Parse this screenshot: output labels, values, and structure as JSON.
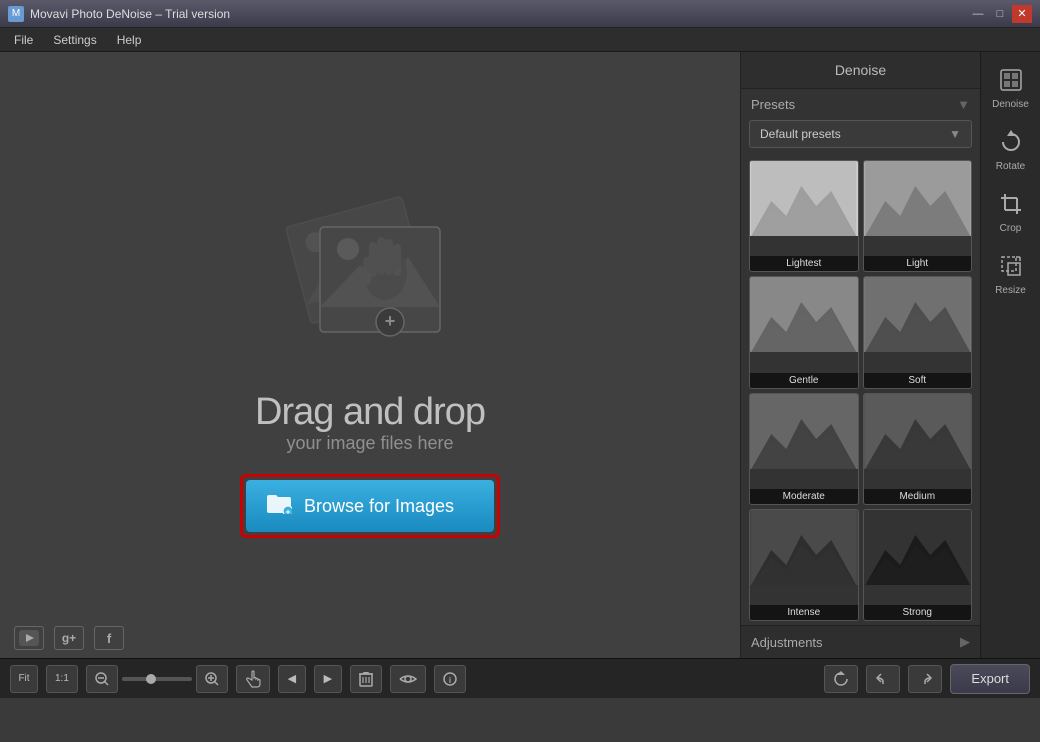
{
  "window": {
    "title": "Movavi Photo DeNoise – Trial version",
    "icon": "M"
  },
  "title_controls": {
    "minimize": "—",
    "maximize": "□",
    "close": "✕"
  },
  "menu": {
    "items": [
      "File",
      "Settings",
      "Help"
    ]
  },
  "canvas": {
    "drag_title": "Drag and drop",
    "drag_subtitle": "your image files here",
    "browse_label": "Browse for Images"
  },
  "social": {
    "youtube": "▶",
    "gplus": "g+",
    "facebook": "f"
  },
  "right_panel": {
    "header": "Denoise",
    "presets_label": "Presets",
    "default_presets": "Default presets",
    "adjustments_label": "Adjustments",
    "presets": [
      {
        "id": "lightest",
        "label": "Lightest",
        "brightness": 85
      },
      {
        "id": "light",
        "label": "Light",
        "brightness": 70
      },
      {
        "id": "gentle",
        "label": "Gentle",
        "brightness": 60
      },
      {
        "id": "soft",
        "label": "Soft",
        "brightness": 55
      },
      {
        "id": "moderate",
        "label": "Moderate",
        "brightness": 50
      },
      {
        "id": "medium",
        "label": "Medium",
        "brightness": 45
      },
      {
        "id": "intense",
        "label": "Intense",
        "brightness": 35
      },
      {
        "id": "strong",
        "label": "Strong",
        "brightness": 30
      }
    ]
  },
  "toolbar": {
    "tools": [
      {
        "id": "denoise",
        "label": "Denoise",
        "icon": "⊞"
      },
      {
        "id": "rotate",
        "label": "Rotate",
        "icon": "↻"
      },
      {
        "id": "crop",
        "label": "Crop",
        "icon": "⊡"
      },
      {
        "id": "resize",
        "label": "Resize",
        "icon": "⤢"
      }
    ]
  },
  "bottom_bar": {
    "fit": "Fit",
    "ratio": "1:1",
    "zoom_minus": "⊖",
    "zoom_plus": "⊕",
    "hand_tool": "✋",
    "prev": "◀",
    "next": "▶",
    "delete": "🗑",
    "eye": "👁",
    "info": "ⓘ",
    "rotate_left": "↺",
    "undo": "↩",
    "redo": "↪",
    "export": "Export"
  }
}
